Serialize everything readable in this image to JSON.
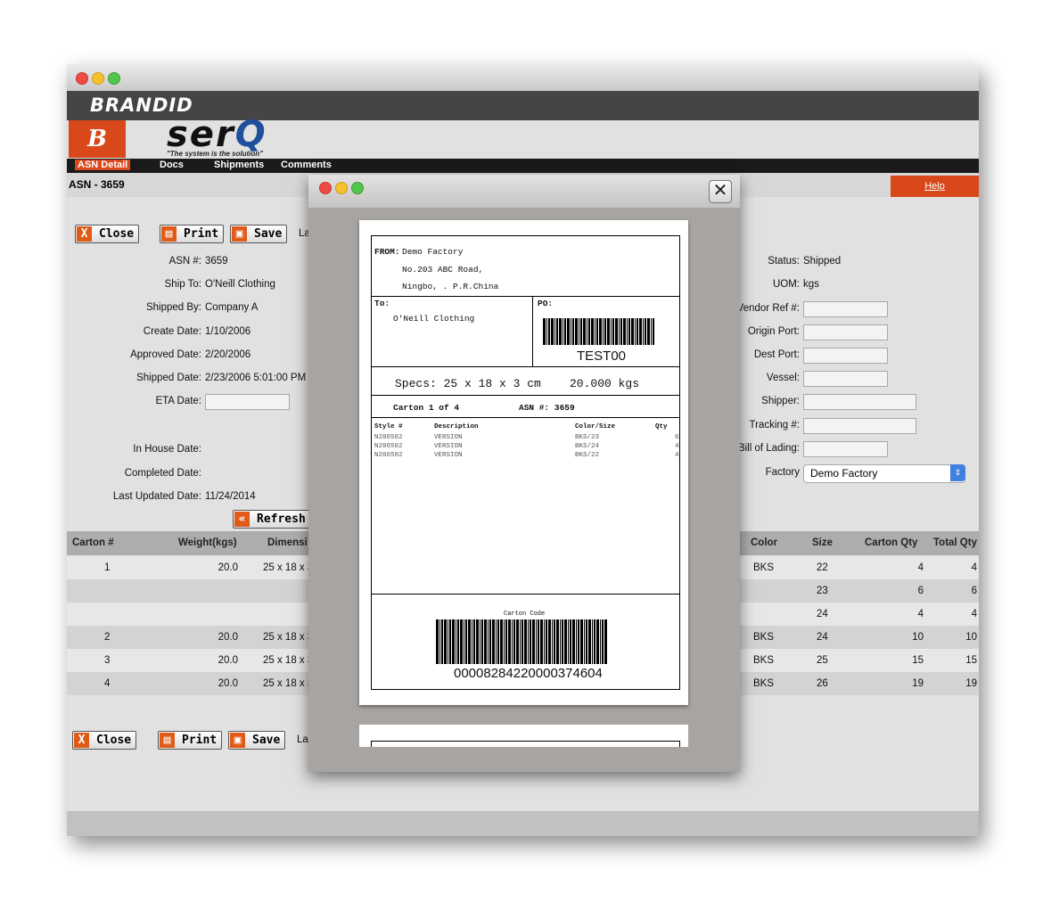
{
  "window": {
    "brand": "BRANDID",
    "logo_mark": "B",
    "product": "ser",
    "product_q": "Q",
    "tagline": "\"The system is the solution\""
  },
  "nav": {
    "tabs": [
      "ASN Detail",
      "Docs",
      "Shipments",
      "Comments"
    ],
    "active": "ASN Detail"
  },
  "page": {
    "title": "ASN - 3659",
    "help": "Help"
  },
  "buttons": {
    "close": "Close",
    "print": "Print",
    "save": "Save",
    "refresh": "Refresh",
    "truncated": "La"
  },
  "details_left": [
    {
      "label": "ASN #:",
      "value": "3659"
    },
    {
      "label": "Ship To:",
      "value": "O'Neill Clothing"
    },
    {
      "label": "Shipped By:",
      "value": "Company A"
    },
    {
      "label": "Create Date:",
      "value": "1/10/2006"
    },
    {
      "label": "Approved Date:",
      "value": "2/20/2006"
    },
    {
      "label": "Shipped Date:",
      "value": "2/23/2006 5:01:00 PM"
    },
    {
      "label": "ETA Date:",
      "value": ""
    },
    {
      "label": "In House Date:",
      "value": ""
    },
    {
      "label": "Completed Date:",
      "value": ""
    },
    {
      "label": "Last Updated Date:",
      "value": "11/24/2014"
    }
  ],
  "details_right": [
    {
      "label": "Status:",
      "value": "Shipped"
    },
    {
      "label": "UOM:",
      "value": "kgs"
    },
    {
      "label": "Vendor Ref #:",
      "value": ""
    },
    {
      "label": "Origin Port:",
      "value": ""
    },
    {
      "label": "Dest Port:",
      "value": ""
    },
    {
      "label": "Vessel:",
      "value": ""
    },
    {
      "label": "Shipper:",
      "value": ""
    },
    {
      "label": "Tracking #:",
      "value": ""
    },
    {
      "label": "Bill of Lading:",
      "value": ""
    },
    {
      "label": "Factory",
      "value": "Demo Factory"
    }
  ],
  "table": {
    "left_headers": [
      "Carton #",
      "Weight(kgs)",
      "Dimensi"
    ],
    "right_headers": [
      "Color",
      "Size",
      "Carton Qty",
      "Total Qty"
    ],
    "rows": [
      {
        "carton": "1",
        "weight": "20.0",
        "dim": "25 x 18 x 3",
        "color": "BKS",
        "size": "22",
        "cqty": "4",
        "tqty": "4"
      },
      {
        "carton": "",
        "weight": "",
        "dim": "",
        "color": "",
        "size": "23",
        "cqty": "6",
        "tqty": "6"
      },
      {
        "carton": "",
        "weight": "",
        "dim": "",
        "color": "",
        "size": "24",
        "cqty": "4",
        "tqty": "4"
      },
      {
        "carton": "2",
        "weight": "20.0",
        "dim": "25 x 18 x 3",
        "color": "BKS",
        "size": "24",
        "cqty": "10",
        "tqty": "10"
      },
      {
        "carton": "3",
        "weight": "20.0",
        "dim": "25 x 18 x 3",
        "color": "BKS",
        "size": "25",
        "cqty": "15",
        "tqty": "15"
      },
      {
        "carton": "4",
        "weight": "20.0",
        "dim": "25 x 18 x 3",
        "color": "BKS",
        "size": "26",
        "cqty": "19",
        "tqty": "19"
      }
    ]
  },
  "label": {
    "from_label": "FROM:",
    "from_name": "Demo Factory",
    "from_addr1": "No.203 ABC Road,",
    "from_addr2": "Ningbo, . P.R.China",
    "to_label": "To:",
    "to_name": "O'Neill Clothing",
    "po_label": "PO:",
    "po_barcode": "TEST00",
    "specs": "Specs: 25 x 18 x 3 cm",
    "weight": "20.000 kgs",
    "carton": "Carton 1 of 4",
    "asn": "ASN #: 3659",
    "items_headers": [
      "Style #",
      "Description",
      "Color/Size",
      "Qty"
    ],
    "items": [
      {
        "style": "N206502",
        "desc": "VERSION",
        "cs": "BKS/23",
        "qty": "6"
      },
      {
        "style": "N206502",
        "desc": "VERSION",
        "cs": "BKS/24",
        "qty": "4"
      },
      {
        "style": "N206502",
        "desc": "VERSION",
        "cs": "BKS/22",
        "qty": "4"
      }
    ],
    "carton_code_label": "Carton Code",
    "carton_code": "00008284220000374604"
  }
}
